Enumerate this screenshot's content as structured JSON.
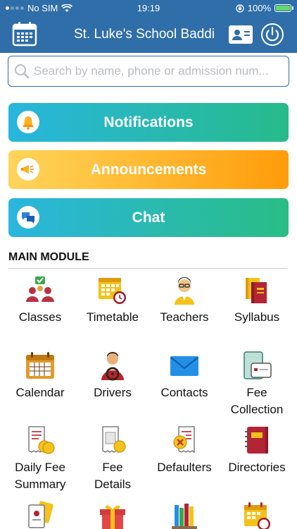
{
  "status_bar": {
    "carrier": "No SIM",
    "time": "19:19",
    "battery": "100%",
    "battery_level": 1.0
  },
  "header": {
    "title": "St. Luke's School Baddi"
  },
  "search": {
    "placeholder": "Search by name, phone or admission num..."
  },
  "quick_actions": [
    {
      "label": "Notifications",
      "icon": "bell-icon"
    },
    {
      "label": "Announcements",
      "icon": "megaphone-icon"
    },
    {
      "label": "Chat",
      "icon": "chat-bubbles-icon"
    }
  ],
  "main_module": {
    "title": "MAIN MODULE",
    "items": [
      {
        "label": "Classes",
        "icon": "classes-icon"
      },
      {
        "label": "Timetable",
        "icon": "timetable-icon"
      },
      {
        "label": "Teachers",
        "icon": "teacher-icon"
      },
      {
        "label": "Syllabus",
        "icon": "books-icon"
      },
      {
        "label": "Calendar",
        "icon": "calendar-icon"
      },
      {
        "label": "Drivers",
        "icon": "driver-icon"
      },
      {
        "label": "Contacts",
        "icon": "envelope-icon"
      },
      {
        "label": "Fee\nCollection",
        "icon": "fee-collection-icon"
      },
      {
        "label": "Daily Fee\nSummary",
        "icon": "daily-fee-summary-icon"
      },
      {
        "label": "Fee\nDetails",
        "icon": "fee-details-icon"
      },
      {
        "label": "Defaulters",
        "icon": "defaulters-icon"
      },
      {
        "label": "Directories",
        "icon": "directory-icon"
      },
      {
        "label": "",
        "icon": "id-cards-icon"
      },
      {
        "label": "",
        "icon": "gift-icon"
      },
      {
        "label": "",
        "icon": "library-icon"
      },
      {
        "label": "",
        "icon": "schedule-icon"
      }
    ]
  },
  "colors": {
    "header_blue": "#2f6ea8",
    "notif_gradient": [
      "#28b6de",
      "#27bb8a"
    ],
    "ann_gradient": [
      "#ffd55a",
      "#ff9c0a"
    ]
  }
}
